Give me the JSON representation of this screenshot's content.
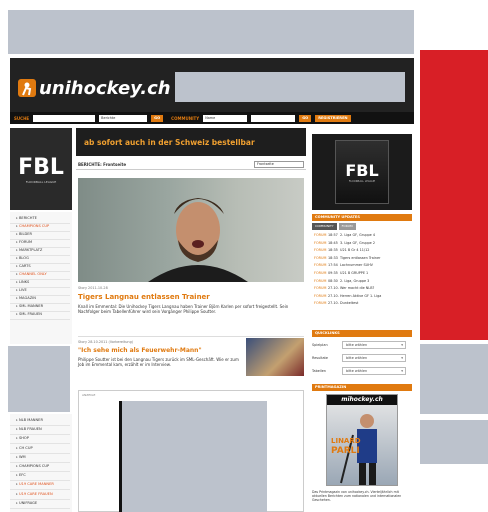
{
  "header": {
    "logo_text": "unihockey.ch",
    "search_label": "SUCHE",
    "search_select": "Berichte",
    "go_label": "GO",
    "community_label": "COMMUNITY",
    "name_placeholder": "Name",
    "go2_label": "GO",
    "register_label": "REGISTRIEREN"
  },
  "banner": {
    "fbl_text": "FBL",
    "fbl_sub": "FLOORBALL LEAGUE",
    "promo_text": "ab sofort auch in der Schweiz bestellbar"
  },
  "main": {
    "berichte_label": "BERICHTE: Frontseite",
    "frontseite_select": "Frontseite",
    "story1_meta": "Story 2011-10-28",
    "story1_title": "Tigers Langnau entlassen Trainer",
    "story1_text": "Knall im Emmental: Die Unihockey Tigers Langnau haben Trainer Björn Karlen per sofort freigestellt. Sein Nachfolger beim Tabellenführer wird sein Vorgänger Philippe Soutter.",
    "story2_meta": "Story 28.10.2011 (Vorbereitung)",
    "story2_title": "\"Ich sehe mich als Feuerwehr-Mann\"",
    "story2_text": "Philippe Soutter ist bei den Langnau Tigers zurück im SML-Geschäft. Wie er zum Job im Emmental kam, erzählt er im Interview.",
    "anzeige_label": "ANZEIGE"
  },
  "sidebar": {
    "items": [
      "BERICHTE",
      "CHAMPIONS CUP",
      "BILDER",
      "FORUM",
      "MARKTPLATZ",
      "BLOG",
      "CARTS",
      "CHANNEL ONLY",
      "LINKS",
      "LIVE",
      "MAGAZIN",
      "SML MANNER",
      "SML FRAUEN"
    ],
    "items2": [
      "NLB MANNER",
      "NLB FRAUEN",
      "SHOP",
      "CH CUP",
      "WM",
      "CHAMPIONS CUP",
      "EFC",
      "U19 CARE MANNER",
      "U19 CARE FRAUEN",
      "UNIFRAGE"
    ]
  },
  "right": {
    "fbl_text": "FBL",
    "fbl_sub": "FLOORBALL LEAGUE",
    "community_head": "COMMUNITY UPDATES",
    "tab1": "COMMUNITY",
    "tab2": "FORUM",
    "updates": [
      {
        "type": "FORUM",
        "time": "18:57",
        "text": "2. Liga GF, Gruppe 4"
      },
      {
        "type": "FORUM",
        "time": "18:45",
        "text": "3. Liga GF, Gruppe 2"
      },
      {
        "type": "FORUM",
        "time": "18:35",
        "text": "U21 B Gr 4 11/12"
      },
      {
        "type": "FORUM",
        "time": "18:33",
        "text": "Tigers entlassen Trainer"
      },
      {
        "type": "FORUM",
        "time": "17:54",
        "text": "Lachnummer SUHV"
      },
      {
        "type": "FORUM",
        "time": "09:35",
        "text": "U21 B GRUPPE 1"
      },
      {
        "type": "FORUM",
        "time": "08:30",
        "text": "2. Liga, Gruppe 3"
      },
      {
        "type": "FORUM",
        "time": "27.10.",
        "text": "Wer macht die NLB?"
      },
      {
        "type": "FORUM",
        "time": "27.10.",
        "text": "Herren Aktive GF 1. Liga"
      },
      {
        "type": "FORUM",
        "time": "27.10.",
        "text": "Dunkeltest"
      }
    ],
    "quicklinks_head": "QUICKLINKS",
    "quicklinks": [
      {
        "label": "Spielplan",
        "value": "bitte wählen"
      },
      {
        "label": "Resultate",
        "value": "bitte wählen"
      },
      {
        "label": "Tabellen",
        "value": "bitte wählen"
      }
    ],
    "magazin_head": "PRINTMAGAZIN",
    "magazin_title": "mihockey.ch",
    "magazin_name1": "LINARD",
    "magazin_name2": "PARLI",
    "magazin_text": "Das Printmagazin von unihockey.ch. Vierteljährlich mit aktuellen Berichten zum nationalen und internationalen Geschehen."
  },
  "colors": {
    "accent": "#e07a10",
    "dark": "#1a1a1a",
    "red": "#d81f26",
    "gray_block": "#bcc2cc"
  }
}
